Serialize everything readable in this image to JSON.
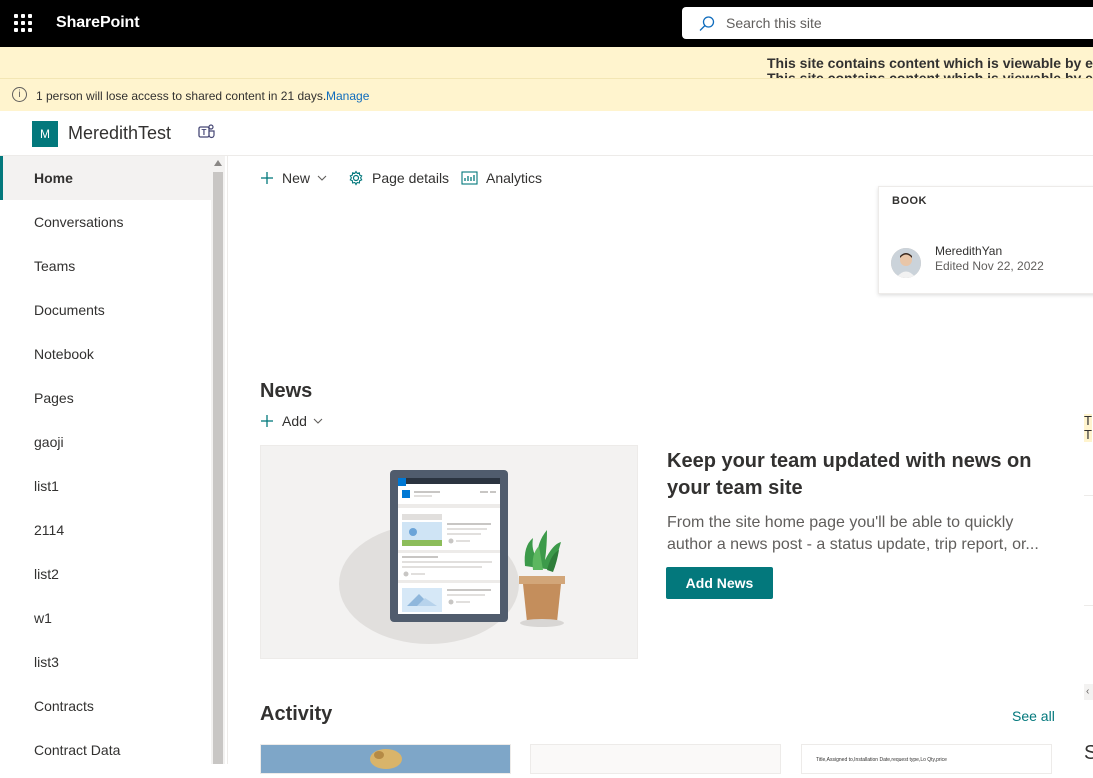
{
  "suite": {
    "brand": "SharePoint",
    "search_placeholder": "Search this site"
  },
  "banners": {
    "external_line1": "This site contains content which is viewable by exte",
    "external_line2": "This site contains content which is viewable by exte",
    "access_message": "1 person will lose access to shared content in 21 days.",
    "access_link": "Manage"
  },
  "site": {
    "logo_letter": "M",
    "title": "MeredithTest"
  },
  "nav": {
    "items": [
      {
        "label": "Home",
        "active": true
      },
      {
        "label": "Conversations"
      },
      {
        "label": "Teams"
      },
      {
        "label": "Documents"
      },
      {
        "label": "Notebook"
      },
      {
        "label": "Pages"
      },
      {
        "label": "gaoji"
      },
      {
        "label": "list1"
      },
      {
        "label": "2114"
      },
      {
        "label": "list2"
      },
      {
        "label": "w1"
      },
      {
        "label": "list3"
      },
      {
        "label": "Contracts"
      },
      {
        "label": "Contract Data"
      }
    ]
  },
  "commandbar": {
    "new_label": "New",
    "page_details_label": "Page details",
    "analytics_label": "Analytics"
  },
  "event_card": {
    "category": "BOOK",
    "author": "MeredithYan",
    "edited": "Edited Nov 22, 2022"
  },
  "news": {
    "title": "News",
    "add_label": "Add",
    "headline": "Keep your team updated with news on your team site",
    "description": "From the site home page you'll be able to quickly author a news post - a status update, trip report, or...",
    "button": "Add News"
  },
  "activity": {
    "title": "Activity",
    "see_all": "See all",
    "doc_snippet": "Title,Assigned to,Installation Date,request type,Lo Qty,price"
  },
  "fragments": {
    "right_t1": "T",
    "right_t2": "T",
    "right_s": "S"
  },
  "colors": {
    "accent": "#03787c",
    "suite_bar": "#000000",
    "banner": "#fff4ce",
    "link": "#0f6cbd"
  }
}
